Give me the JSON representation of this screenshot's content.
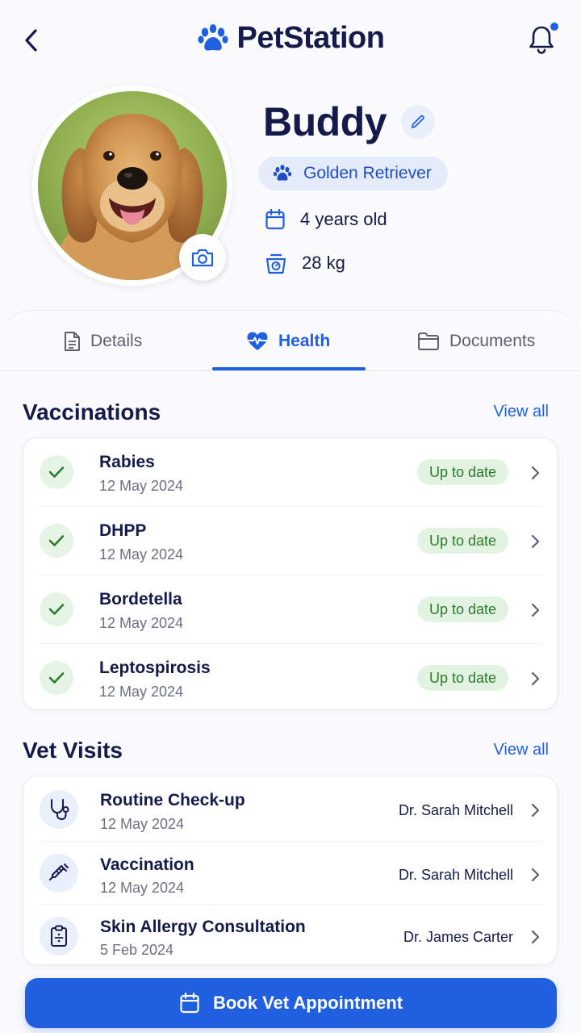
{
  "header": {
    "brand": "PetStation",
    "has_notification": true
  },
  "profile": {
    "name": "Buddy",
    "breed": "Golden Retriever",
    "age": "4 years old",
    "weight": "28 kg"
  },
  "tabs": [
    {
      "label": "Details",
      "icon": "document-icon",
      "active": false
    },
    {
      "label": "Health",
      "icon": "heart-pulse-icon",
      "active": true
    },
    {
      "label": "Documents",
      "icon": "folder-icon",
      "active": false
    }
  ],
  "vaccinations": {
    "title": "Vaccinations",
    "view_all": "View all",
    "items": [
      {
        "name": "Rabies",
        "date": "12 May 2024",
        "status": "Up to date"
      },
      {
        "name": "DHPP",
        "date": "12 May 2024",
        "status": "Up to date"
      },
      {
        "name": "Bordetella",
        "date": "12 May 2024",
        "status": "Up to date"
      },
      {
        "name": "Leptospirosis",
        "date": "12 May 2024",
        "status": "Up to date"
      }
    ]
  },
  "vet_visits": {
    "title": "Vet Visits",
    "view_all": "View all",
    "items": [
      {
        "title": "Routine Check-up",
        "date": "12 May 2024",
        "doctor": "Dr. Sarah Mitchell",
        "icon": "stethoscope-icon"
      },
      {
        "title": "Vaccination",
        "date": "12 May 2024",
        "doctor": "Dr. Sarah Mitchell",
        "icon": "syringe-icon"
      },
      {
        "title": "Skin Allergy Consultation",
        "date": "5 Feb 2024",
        "doctor": "Dr. James Carter",
        "icon": "clipboard-icon"
      }
    ]
  },
  "cta": {
    "label": "Book Vet Appointment"
  },
  "colors": {
    "accent": "#1f5fe0",
    "ink": "#141a4a",
    "success": "#2b7a2e",
    "success_bg": "#e3f3e2"
  }
}
